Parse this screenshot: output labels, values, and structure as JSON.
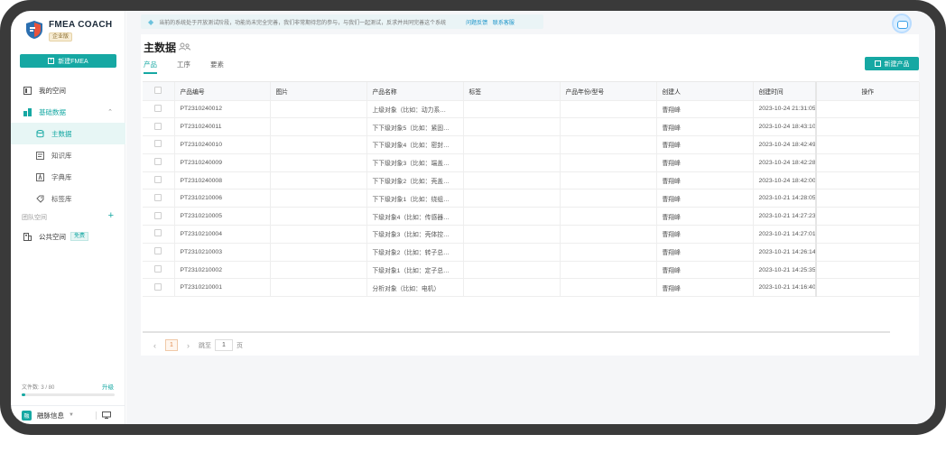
{
  "app": {
    "brand": "FMEA COACH",
    "edition": "企业版"
  },
  "sidebar": {
    "new_button": "新建FMEA",
    "items": [
      {
        "label": "我的空间",
        "icon": "my-space-icon"
      },
      {
        "label": "基础数据",
        "icon": "base-data-icon"
      },
      {
        "label": "主数据",
        "icon": "master-data-icon"
      },
      {
        "label": "知识库",
        "icon": "knowledge-base-icon"
      },
      {
        "label": "字典库",
        "icon": "dictionary-icon"
      },
      {
        "label": "标签库",
        "icon": "tag-library-icon"
      }
    ],
    "team_label": "团队空间",
    "public_space": "公共空间",
    "public_tag": "免费",
    "file_count": "文件数: 3 / 80",
    "upgrade": "升级",
    "file_progress": 0.0375,
    "user_name": "融脉信息",
    "user_avatar": "融"
  },
  "notice": {
    "text": "当前的系统处于开放测试阶段，功能尚未完全完善，我们非常期待您的参与，与我们一起测试，反求并共同完善这个系统",
    "link_feedback": "问题反馈",
    "link_contact": "联系客服"
  },
  "page": {
    "title": "主数据",
    "tabs": [
      "产品",
      "工序",
      "要素"
    ],
    "active_tab": 0,
    "add_button": "新建产品"
  },
  "table": {
    "columns": [
      "产品编号",
      "图片",
      "产品名称",
      "标签",
      "产品年份/型号",
      "创建人",
      "创建时间",
      "操作"
    ],
    "rows": [
      {
        "code": "PT2310240012",
        "image": "",
        "name": "上级对象（比如：动力系…",
        "tag": "",
        "model": "",
        "creator": "曹翔峰",
        "created": "2023-10-24 21:31:05"
      },
      {
        "code": "PT2310240011",
        "image": "",
        "name": "下下级对象5（比如：紧固…",
        "tag": "",
        "model": "",
        "creator": "曹翔峰",
        "created": "2023-10-24 18:43:10"
      },
      {
        "code": "PT2310240010",
        "image": "",
        "name": "下下级对象4（比如：密封…",
        "tag": "",
        "model": "",
        "creator": "曹翔峰",
        "created": "2023-10-24 18:42:49"
      },
      {
        "code": "PT2310240009",
        "image": "",
        "name": "下下级对象3（比如：端盖…",
        "tag": "",
        "model": "",
        "creator": "曹翔峰",
        "created": "2023-10-24 18:42:28"
      },
      {
        "code": "PT2310240008",
        "image": "",
        "name": "下下级对象2（比如：壳盖…",
        "tag": "",
        "model": "",
        "creator": "曹翔峰",
        "created": "2023-10-24 18:42:00"
      },
      {
        "code": "PT2310210006",
        "image": "",
        "name": "下下级对象1（比如：绕组…",
        "tag": "",
        "model": "",
        "creator": "曹翔峰",
        "created": "2023-10-21 14:28:05"
      },
      {
        "code": "PT2310210005",
        "image": "",
        "name": "下级对象4（比如：传感器…",
        "tag": "",
        "model": "",
        "creator": "曹翔峰",
        "created": "2023-10-21 14:27:23"
      },
      {
        "code": "PT2310210004",
        "image": "",
        "name": "下级对象3（比如：壳体控…",
        "tag": "",
        "model": "",
        "creator": "曹翔峰",
        "created": "2023-10-21 14:27:01"
      },
      {
        "code": "PT2310210003",
        "image": "",
        "name": "下级对象2（比如：转子总…",
        "tag": "",
        "model": "",
        "creator": "曹翔峰",
        "created": "2023-10-21 14:26:14"
      },
      {
        "code": "PT2310210002",
        "image": "",
        "name": "下级对象1（比如：定子总…",
        "tag": "",
        "model": "",
        "creator": "曹翔峰",
        "created": "2023-10-21 14:25:35"
      },
      {
        "code": "PT2310210001",
        "image": "",
        "name": "分析对象（比如：电机）",
        "tag": "",
        "model": "",
        "creator": "曹翔峰",
        "created": "2023-10-21 14:16:40"
      }
    ]
  },
  "pager": {
    "current": "1",
    "goto_label": "跳至",
    "goto_value": "1",
    "goto_suffix": "页"
  }
}
